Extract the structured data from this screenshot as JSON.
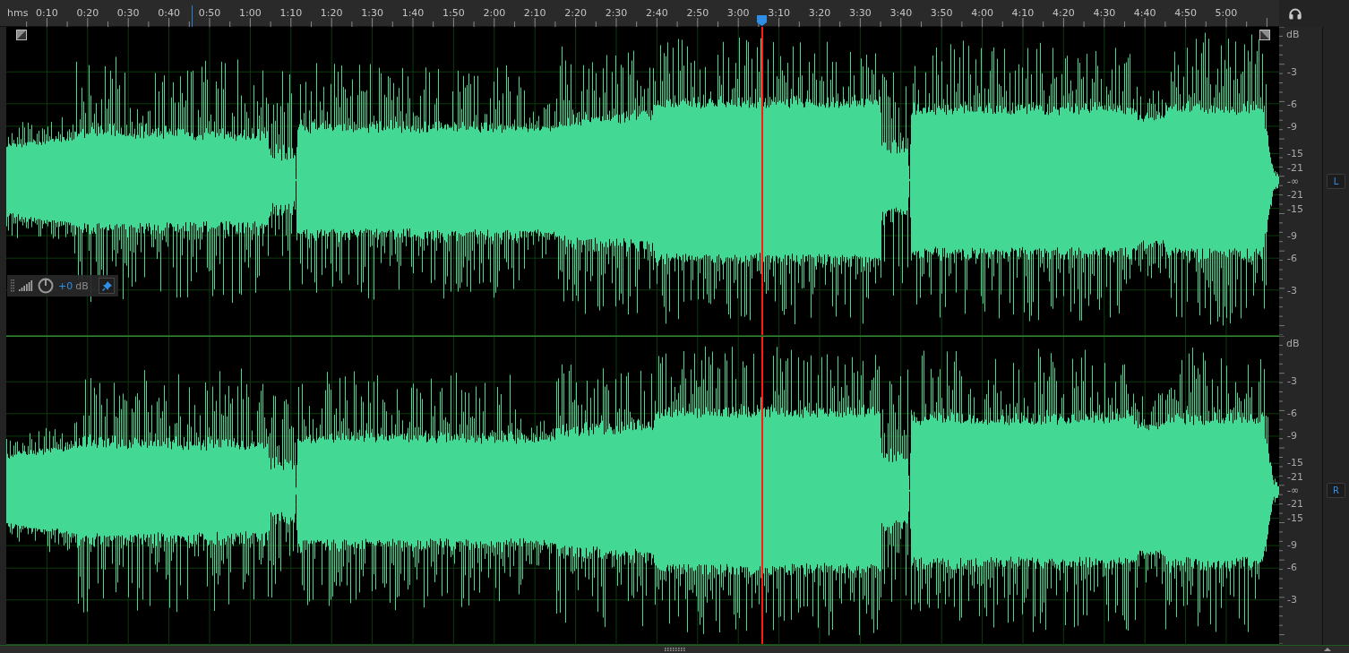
{
  "ruler": {
    "unit": "hms",
    "ticks": [
      "0:10",
      "0:20",
      "0:30",
      "0:40",
      "0:50",
      "1:00",
      "1:10",
      "1:20",
      "1:30",
      "1:40",
      "1:50",
      "2:00",
      "2:10",
      "2:20",
      "2:30",
      "2:40",
      "2:50",
      "3:00",
      "3:10",
      "3:20",
      "3:30",
      "3:40",
      "3:50",
      "4:00",
      "4:10",
      "4:20",
      "4:30",
      "4:40",
      "4:50",
      "5:00"
    ]
  },
  "marker": {
    "level": 0.146
  },
  "playhead": {
    "level": 0.593
  },
  "channels": [
    {
      "label": "L",
      "scale": {
        "unit": "dB",
        "upper": [
          "-3",
          "-6",
          "-9",
          "-15",
          "-21"
        ],
        "center": "-∞",
        "lower": [
          "-21",
          "-15",
          "-9",
          "-6",
          "-3"
        ]
      }
    },
    {
      "label": "R",
      "scale": {
        "unit": "dB",
        "upper": [
          "-3",
          "-6",
          "-9",
          "-15",
          "-21"
        ],
        "center": "-∞",
        "lower": [
          "-21",
          "-15",
          "-9",
          "-6",
          "-3"
        ]
      }
    }
  ],
  "hud": {
    "value": "+0",
    "unit": "dB"
  }
}
